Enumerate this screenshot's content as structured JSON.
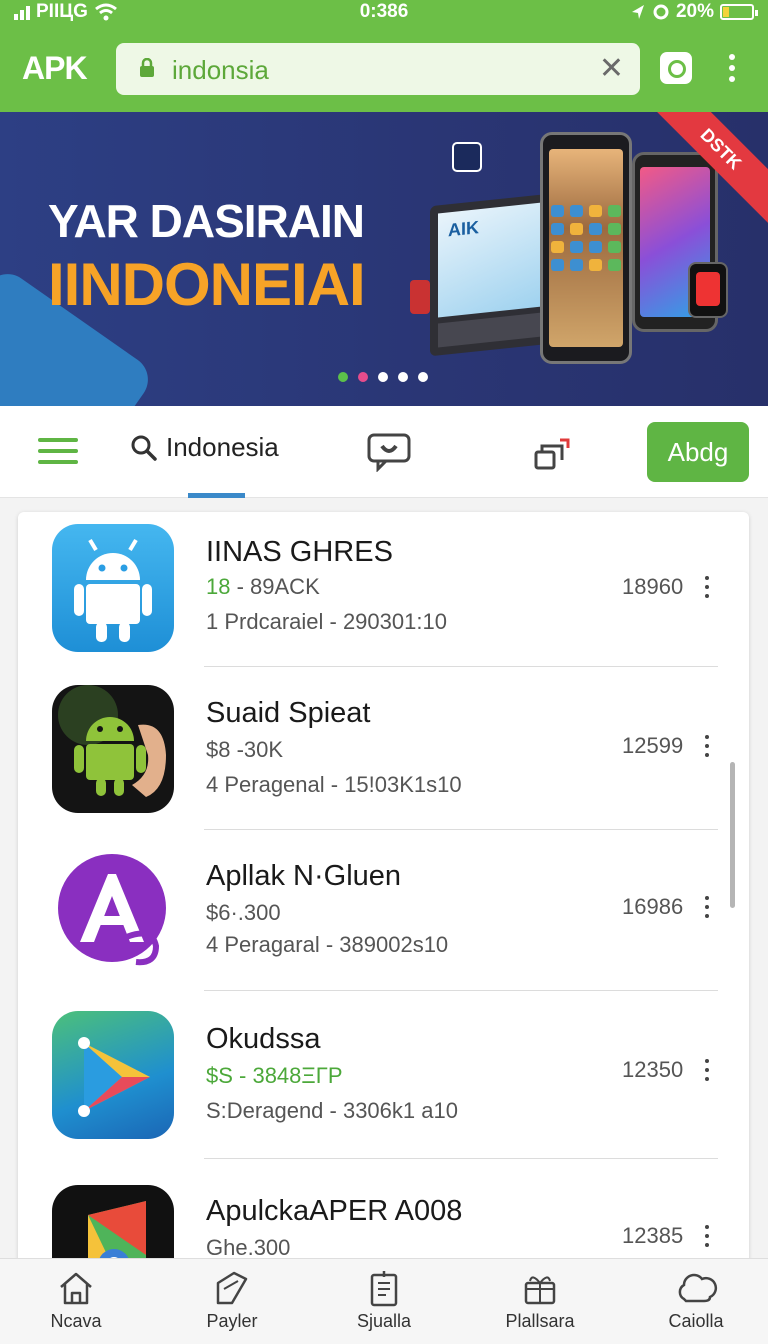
{
  "status_bar": {
    "carrier": "PIIЦG",
    "time": "0:386",
    "battery": "20%"
  },
  "app_bar": {
    "logo": "APK",
    "url": "indonsia",
    "colors": {
      "brand_green": "#6cbf47",
      "accent_orange": "#f5c23a"
    }
  },
  "banner": {
    "line1": "YAR DASIRAIN",
    "line2": "IINDONEIAI",
    "ribbon": "DSTK",
    "laptop_label": "AIK",
    "carousel_dots": 5
  },
  "toolbar": {
    "search_label": "Indonesia",
    "add_button_label": "Abdg"
  },
  "apps": [
    {
      "title": "IINAS GHRES",
      "price": "18 - 89ACK",
      "meta": "1 Prdcaraiel - 290301:10",
      "count": "18960",
      "price_green": "18"
    },
    {
      "title": "Suaid Spieat",
      "price": "$8 -30K",
      "meta": "4 Peragenal - 15!03K1s10",
      "count": "12599"
    },
    {
      "title": "Apllak N·Gluen",
      "price": "$6·.300",
      "meta": "4 Peragaral - 389002s10",
      "count": "16986"
    },
    {
      "title": "Okudssa",
      "price": "$S - 3848ΞΓΡ",
      "meta": "S:Deragend - 3306k1 a10",
      "count": "12350"
    },
    {
      "title": "ApulckaAPER A008",
      "price": "Ghe.300",
      "meta": "",
      "count": "12385"
    }
  ],
  "bottom_nav": [
    {
      "label": "Ncava",
      "icon": "home-icon"
    },
    {
      "label": "Payler",
      "icon": "tag-icon"
    },
    {
      "label": "Sjualla",
      "icon": "document-icon"
    },
    {
      "label": "Plallsara",
      "icon": "gift-icon"
    },
    {
      "label": "Caiolla",
      "icon": "cloud-icon"
    }
  ]
}
